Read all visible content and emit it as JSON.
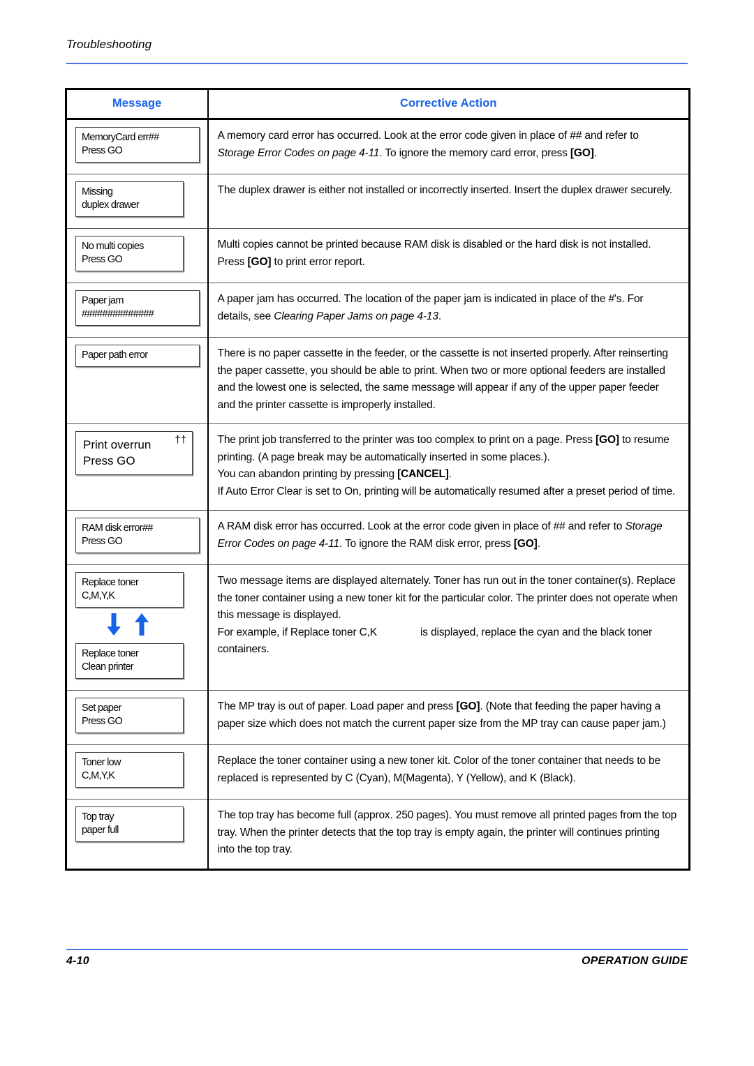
{
  "header": {
    "title": "Troubleshooting",
    "rule_color": "#4a6fe0"
  },
  "table": {
    "columns": [
      {
        "label": "Message"
      },
      {
        "label": "Corrective Action"
      }
    ],
    "header_color": "#1763e8",
    "rows": [
      {
        "id": "memorycard-err",
        "message_lines": [
          "MemoryCard err##",
          "Press GO"
        ],
        "action_segments": [
          {
            "t": "A memory card error has occurred. Look at the error code given in place of ## and refer to ",
            "s": "normal"
          },
          {
            "t": "Storage Error Codes on page 4-11",
            "s": "italic"
          },
          {
            "t": ". To ignore the memory card error, press ",
            "s": "normal"
          },
          {
            "t": "[GO]",
            "s": "bold"
          },
          {
            "t": ".",
            "s": "normal"
          }
        ]
      },
      {
        "id": "missing-duplex-drawer",
        "message_lines": [
          "Missing",
          "duplex drawer"
        ],
        "action_segments": [
          {
            "t": "The duplex drawer is either not installed or incorrectly inserted. Insert the duplex drawer securely.",
            "s": "normal"
          }
        ]
      },
      {
        "id": "no-multi-copies",
        "message_lines": [
          "No multi copies",
          "Press GO"
        ],
        "action_segments": [
          {
            "t": "Multi copies cannot be printed because RAM disk is disabled or the hard disk is not installed. Press ",
            "s": "normal"
          },
          {
            "t": "[GO]",
            "s": "bold"
          },
          {
            "t": " to print error report.",
            "s": "normal"
          }
        ]
      },
      {
        "id": "paper-jam",
        "message_lines": [
          "Paper jam",
          "##############"
        ],
        "action_segments": [
          {
            "t": "A paper jam has occurred. The location of the paper jam is indicated in place of the #'s. For details, see ",
            "s": "normal"
          },
          {
            "t": "Clearing Paper Jams on page 4-13",
            "s": "italic"
          },
          {
            "t": ".",
            "s": "normal"
          }
        ]
      },
      {
        "id": "paper-path-error",
        "message_lines": [
          "Paper path error"
        ],
        "action_segments": [
          {
            "t": "There is no paper cassette in the feeder, or the cassette is not inserted properly. After reinserting the paper cassette, you should be able to print. When two or more optional feeders are installed and the lowest one is selected, the same message will appear if any of the upper paper feeder and the printer cassette is improperly installed.",
            "s": "normal"
          }
        ]
      },
      {
        "id": "print-overrun",
        "message_lines": [
          "Print overrun",
          "Press GO"
        ],
        "message_marker": "††",
        "action_segments": [
          {
            "t": "The print job transferred to the printer was too complex to print on a page. Press ",
            "s": "normal"
          },
          {
            "t": "[GO]",
            "s": "bold"
          },
          {
            "t": " to resume printing. (A page break may be automatically inserted in some places.).",
            "s": "normal"
          },
          {
            "t": "BR",
            "s": "break"
          },
          {
            "t": "You can abandon printing by pressing ",
            "s": "normal"
          },
          {
            "t": "[CANCEL]",
            "s": "bold"
          },
          {
            "t": ".",
            "s": "normal"
          },
          {
            "t": "BR",
            "s": "break"
          },
          {
            "t": "If Auto Error Clear is set to On, printing will be automatically resumed after a preset period of time.",
            "s": "normal"
          }
        ]
      },
      {
        "id": "ram-disk-error",
        "message_lines": [
          "RAM disk error##",
          "Press GO"
        ],
        "action_segments": [
          {
            "t": "A RAM disk error has occurred. Look at the error code given in place of ## and refer to ",
            "s": "normal"
          },
          {
            "t": "Storage Error Codes on page 4-11",
            "s": "italic"
          },
          {
            "t": ". To ignore the RAM disk error, press ",
            "s": "normal"
          },
          {
            "t": "[GO]",
            "s": "bold"
          },
          {
            "t": ".",
            "s": "normal"
          }
        ]
      },
      {
        "id": "replace-toner",
        "message_lines": [
          "Replace toner",
          "C,M,Y,K"
        ],
        "message_lines_2": [
          "Replace toner",
          "Clean printer"
        ],
        "arrows": {
          "down": "↓",
          "up": "↑",
          "color": "#1763e8"
        },
        "action_segments": [
          {
            "t": "Two message items are displayed alternately. Toner has run out in the toner container(s). Replace the toner container using a new toner kit for the particular color. The printer does not operate when this message is displayed.",
            "s": "normal"
          },
          {
            "t": "BR",
            "s": "break"
          },
          {
            "t": "For example, if Replace toner C,K",
            "s": "normal"
          },
          {
            "t": "GAP",
            "s": "gap"
          },
          {
            "t": "is displayed, replace the cyan and the black toner containers.",
            "s": "normal"
          }
        ]
      },
      {
        "id": "set-paper",
        "message_lines": [
          "Set paper",
          "Press GO"
        ],
        "action_segments": [
          {
            "t": "The MP tray is out of paper. Load paper and press ",
            "s": "normal"
          },
          {
            "t": "[GO]",
            "s": "bold"
          },
          {
            "t": ". (Note that feeding the paper having a paper size which does not match the current paper size from the MP tray can cause paper jam.)",
            "s": "normal"
          }
        ]
      },
      {
        "id": "toner-low",
        "message_lines": [
          "Toner low",
          "C,M,Y,K"
        ],
        "action_segments": [
          {
            "t": "Replace the toner container using a new toner kit. Color of the toner container that needs to be replaced is represented by C (Cyan), M(Magenta), Y (Yellow), and K (Black).",
            "s": "normal"
          }
        ]
      },
      {
        "id": "top-tray-paper-full",
        "message_lines": [
          "Top tray",
          "paper full"
        ],
        "action_segments": [
          {
            "t": "The top tray has become full (approx. 250 pages). You must remove all printed pages from the top tray. When the printer detects that the top tray is empty again, the printer will continues printing into the top tray.",
            "s": "normal"
          }
        ]
      }
    ]
  },
  "footer": {
    "page_number": "4-10",
    "guide_label": "OPERATION GUIDE",
    "rule_color": "#4a6fe0"
  }
}
